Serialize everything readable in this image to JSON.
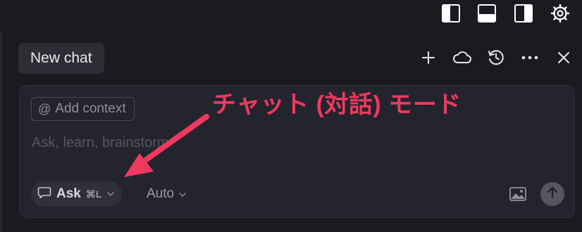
{
  "topbar": {
    "icons": [
      "toggle-left-sidebar-icon",
      "toggle-bottom-panel-icon",
      "toggle-right-sidebar-icon",
      "gear-icon"
    ]
  },
  "chat_header": {
    "tab_label": "New chat",
    "actions": [
      "plus-icon",
      "cloud-icon",
      "history-icon",
      "more-icon",
      "close-icon"
    ]
  },
  "composer": {
    "add_context_symbol": "@",
    "add_context_label": "Add context",
    "placeholder": "Ask, learn, brainstorm",
    "mode_label": "Ask",
    "mode_shortcut": "⌘L",
    "model_label": "Auto"
  },
  "annotation": {
    "text": "チャット (対話) モード",
    "color": "#f0395f"
  }
}
